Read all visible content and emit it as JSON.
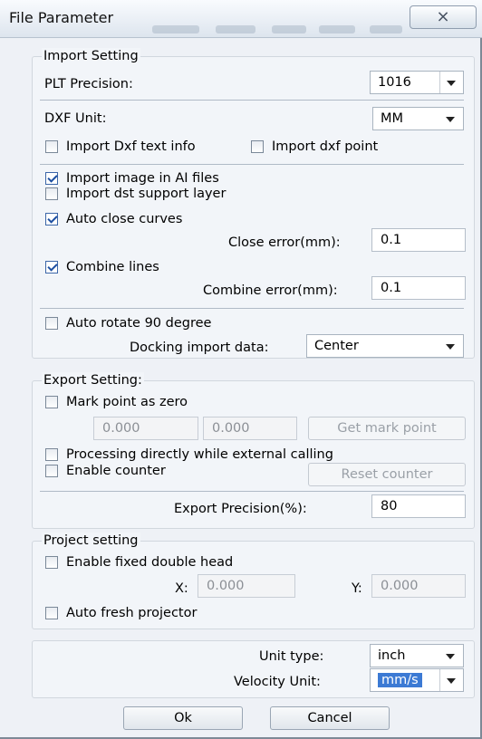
{
  "window": {
    "title": "File Parameter",
    "close_glyph": "⨯"
  },
  "import_setting": {
    "title": "Import Setting",
    "plt_precision_label": "PLT Precision:",
    "plt_precision_value": "1016",
    "dxf_unit_label": "DXF Unit:",
    "dxf_unit_value": "MM",
    "import_dxf_text_info": {
      "label": "Import Dxf text info",
      "checked": false
    },
    "import_dxf_point": {
      "label": "Import dxf point",
      "checked": false
    },
    "import_image_ai": {
      "label": "Import image in AI files",
      "checked": true
    },
    "import_dst_support": {
      "label": "Import dst support layer",
      "checked": false
    },
    "auto_close_curves": {
      "label": "Auto close curves",
      "checked": true
    },
    "close_error_label": "Close error(mm):",
    "close_error_value": "0.1",
    "combine_lines": {
      "label": "Combine lines",
      "checked": true
    },
    "combine_error_label": "Combine error(mm):",
    "combine_error_value": "0.1",
    "auto_rotate": {
      "label": "Auto rotate 90 degree",
      "checked": false
    },
    "docking_label": "Docking import data:",
    "docking_value": "Center"
  },
  "export_setting": {
    "title": "Export Setting:",
    "mark_point_zero": {
      "label": "Mark point as zero",
      "checked": false
    },
    "mark_x": "0.000",
    "mark_y": "0.000",
    "get_mark_point": "Get mark point",
    "processing_directly": {
      "label": "Processing directly while external calling",
      "checked": false
    },
    "enable_counter": {
      "label": "Enable counter",
      "checked": false
    },
    "reset_counter": "Reset counter",
    "export_precision_label": "Export Precision(%):",
    "export_precision_value": "80"
  },
  "project_setting": {
    "title": "Project setting",
    "fixed_double_head": {
      "label": "Enable fixed double head",
      "checked": false
    },
    "x_label": "X:",
    "x_value": "0.000",
    "y_label": "Y:",
    "y_value": "0.000",
    "auto_fresh_projector": {
      "label": "Auto fresh projector",
      "checked": false
    }
  },
  "units": {
    "unit_type_label": "Unit type:",
    "unit_type_value": "inch",
    "velocity_unit_label": "Velocity Unit:",
    "velocity_unit_value": "mm/s"
  },
  "footer": {
    "ok": "Ok",
    "cancel": "Cancel"
  }
}
